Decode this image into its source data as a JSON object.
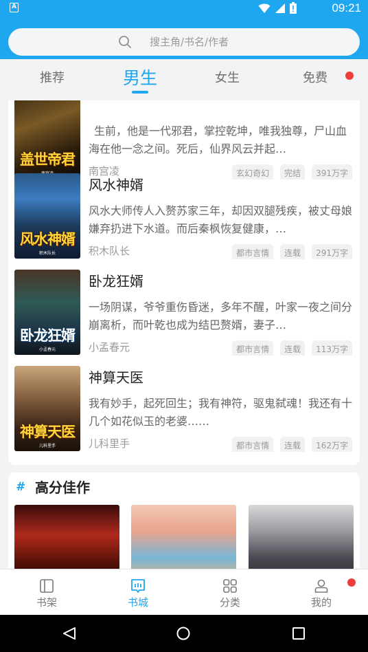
{
  "status_bar": {
    "time": "09:21",
    "app_icon_letter": "A"
  },
  "search": {
    "placeholder": "搜主角/书名/作者"
  },
  "tabs": [
    {
      "label": "推荐",
      "active": false
    },
    {
      "label": "男生",
      "active": true
    },
    {
      "label": "女生",
      "active": false
    },
    {
      "label": "免费",
      "active": false,
      "badge_dot": true
    }
  ],
  "books": [
    {
      "title": "",
      "cover_text": "盖世帝君",
      "cover_sub": "南宫凌",
      "desc": "生前，他是一代邪君，掌控乾坤，唯我独尊，尸山血海在他一念之间。死后，仙界风云并起…",
      "author": "南宫凌",
      "tags": [
        "玄幻奇幻",
        "完结",
        "391万字"
      ]
    },
    {
      "title": "风水神婿",
      "cover_text": "风水神婿",
      "cover_sub": "积木队长",
      "desc": "风水大师传人入赘苏家三年，却因双腿残疾，被丈母娘嫌弃扔进下水道。而后秦枫恢复健康，…",
      "author": "积木队长",
      "tags": [
        "都市言情",
        "连载",
        "291万字"
      ]
    },
    {
      "title": "卧龙狂婿",
      "cover_text": "卧龙狂婿",
      "cover_sub": "小孟春元",
      "desc": "一场阴谋，爷爷重伤昏迷，多年不醒，叶家一夜之间分崩离析，而叶乾也成为结巴赘婿，妻子…",
      "author": "小孟春元",
      "tags": [
        "都市言情",
        "连载",
        "113万字"
      ]
    },
    {
      "title": "神算天医",
      "cover_text": "神算天医",
      "cover_sub": "儿科里手",
      "desc": "我有妙手，起死回生；我有神符，驱鬼弑魂！我还有十几个如花似玉的老婆……",
      "author": "儿科里手",
      "tags": [
        "都市言情",
        "连载",
        "162万字"
      ]
    }
  ],
  "high_score": {
    "title": "高分佳作"
  },
  "bottom_nav": [
    {
      "label": "书架",
      "icon": "bookshelf-icon",
      "active": false
    },
    {
      "label": "书城",
      "icon": "bookstore-icon",
      "active": true
    },
    {
      "label": "分类",
      "icon": "category-grid-icon",
      "active": false
    },
    {
      "label": "我的",
      "icon": "profile-icon",
      "active": false,
      "badge_dot": true
    }
  ],
  "colors": {
    "accent": "#1ea7ef",
    "badge": "#ef3d3d"
  }
}
